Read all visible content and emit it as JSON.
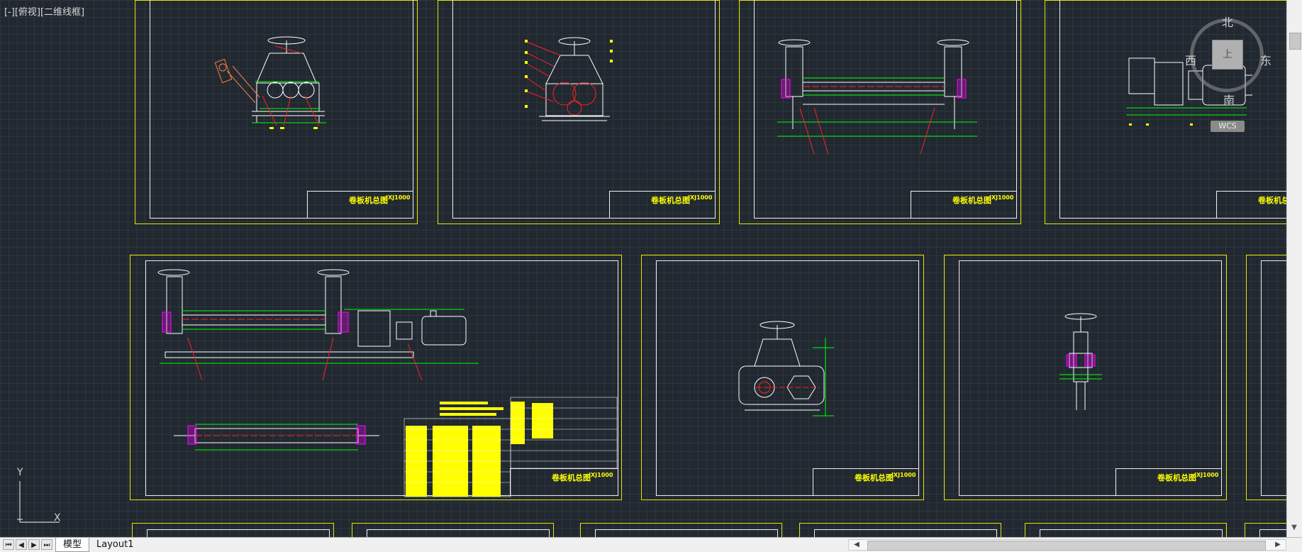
{
  "viewport": {
    "label": "[-][俯视][二维线框]"
  },
  "viewcube": {
    "north": "北",
    "south": "南",
    "east": "东",
    "west": "西",
    "face": "上",
    "wcs": "WCS"
  },
  "ucs": {
    "x": "X",
    "y": "Y"
  },
  "title_block_text": "卷板机总图",
  "drawing_number": "JXJ1000",
  "tabs": {
    "model": "模型",
    "layout1": "Layout1"
  },
  "nav": {
    "first": "⏮",
    "prev": "◀",
    "next": "▶",
    "last": "⏭"
  },
  "colors": {
    "background": "#212830",
    "sheet_border": "#e6e600",
    "frame": "#f0f0f0",
    "dimension": "#00ff00",
    "centerline": "#ff2020",
    "hatch": "#ff00ff"
  }
}
